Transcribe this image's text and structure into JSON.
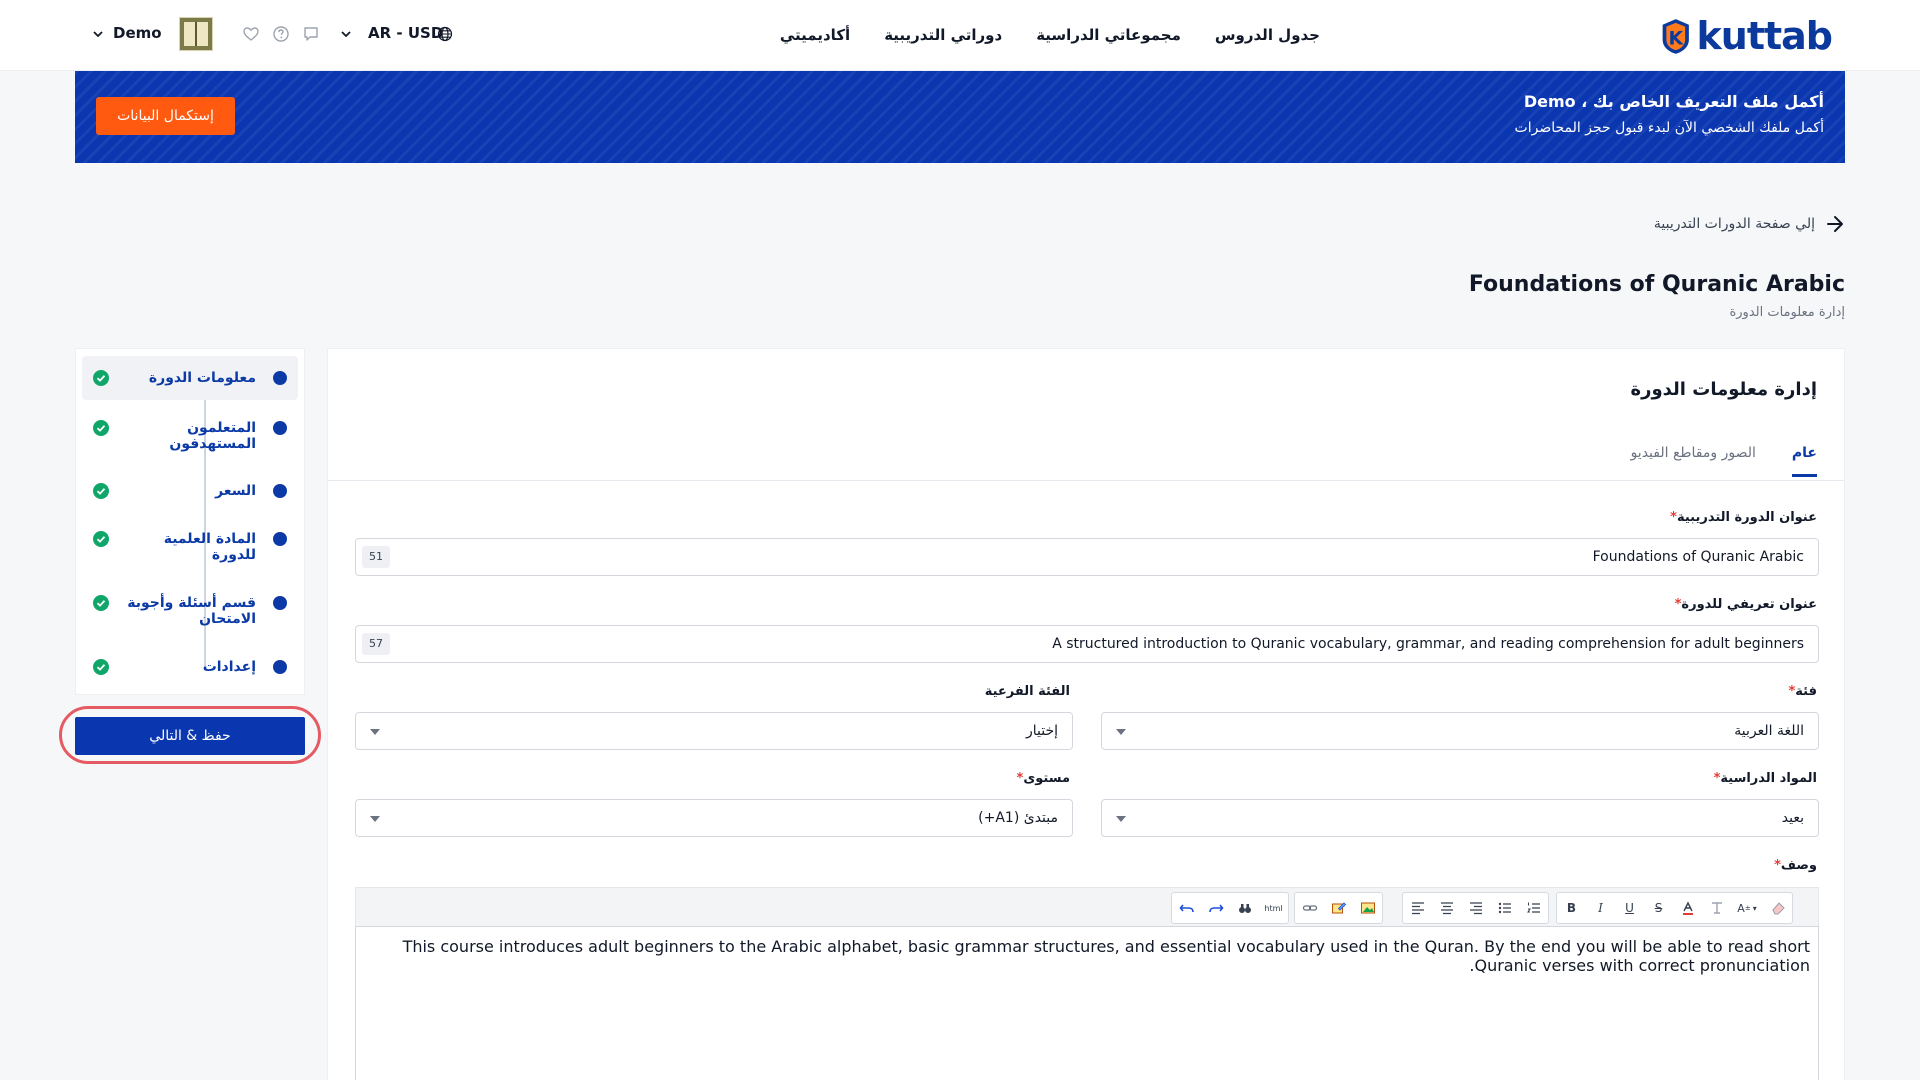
{
  "header": {
    "logo_text": "kuttab",
    "nav": [
      "جدول الدروس",
      "مجموعاتي الدراسية",
      "دوراتي التدريبية",
      "أكاديميتي"
    ],
    "language": "AR - USD",
    "user_name": "Demo"
  },
  "banner": {
    "title": "أكمل ملف التعريف الخاص بك ، Demo",
    "subtitle": "أكمل ملفك الشخصي الآن لبدء قبول حجز المحاضرات",
    "button": "إستكمال البيانات"
  },
  "back_link": "إلي صفحة الدورات التدريبية",
  "page": {
    "title": "Foundations of Quranic Arabic",
    "subtitle": "إدارة معلومات الدورة"
  },
  "steps": [
    {
      "label": "معلومات الدورة"
    },
    {
      "label": "المتعلمون المستهدفون"
    },
    {
      "label": "السعر"
    },
    {
      "label": "المادة العلمية للدورة"
    },
    {
      "label": "قسم أسئلة وأجوبة الامتحان"
    },
    {
      "label": "إعدادات"
    }
  ],
  "save_button": "حفظ & التالي",
  "card": {
    "title": "إدارة معلومات الدورة",
    "tabs": [
      "عام",
      "الصور ومقاطع الفيديو"
    ]
  },
  "form": {
    "course_title": {
      "label": "عنوان الدورة التدريبية",
      "value": "Foundations of Quranic Arabic",
      "count": "51"
    },
    "intro_title": {
      "label": "عنوان تعريفي للدورة",
      "value": "A structured introduction to Quranic vocabulary, grammar, and reading comprehension for adult beginners",
      "count": "57"
    },
    "category": {
      "label": "فئة",
      "value": "اللغة العربية"
    },
    "subcategory": {
      "label": "الفئة الفرعية",
      "value": "إختيار"
    },
    "subjects": {
      "label": "المواد الدراسية",
      "value": "بعيد"
    },
    "level": {
      "label": "مستوى",
      "value": "مبتدئ (A1+)"
    },
    "description": {
      "label": "وصف",
      "value": "This course introduces adult beginners to the Arabic alphabet, basic grammar structures, and essential vocabulary used in the Quran. By the end you will be able to read short Quranic verses with correct pronunciation."
    },
    "required_mark": "*"
  },
  "toolbar": {
    "font_size": "A",
    "html": "html"
  },
  "colors": {
    "primary": "#0a36b0",
    "accent": "#ff5a0f",
    "success": "#10a66a",
    "highlight": "#e45b63"
  }
}
